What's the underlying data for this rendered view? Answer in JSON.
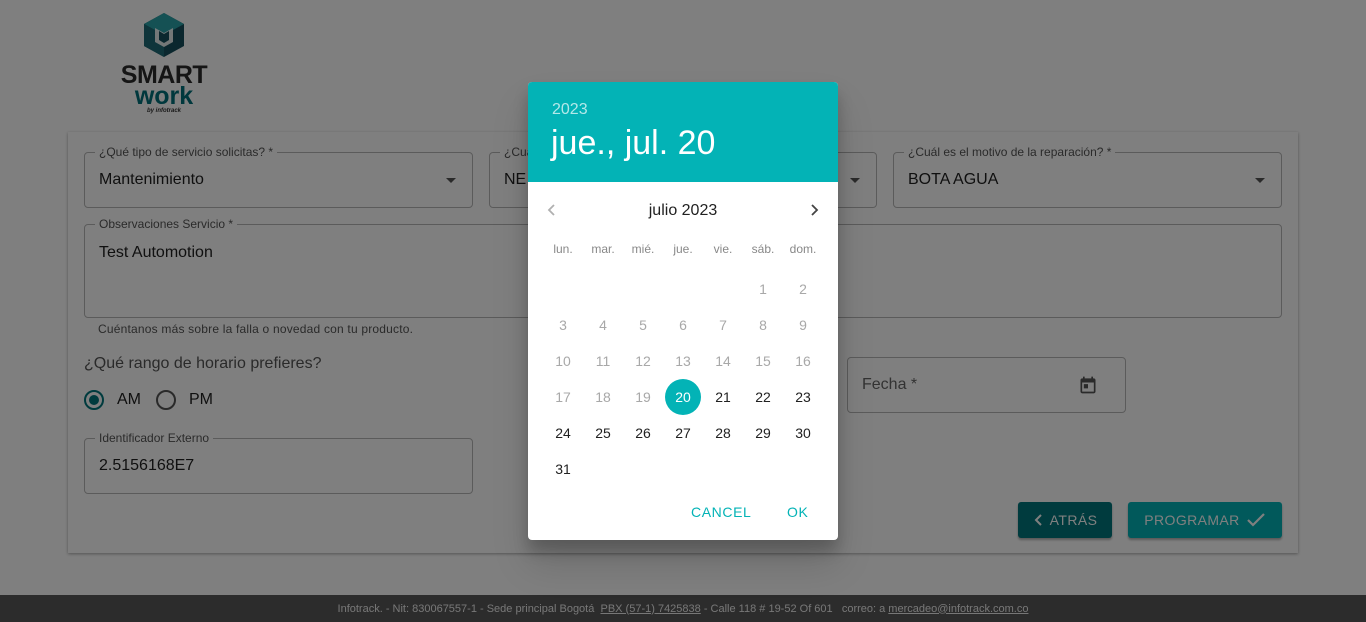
{
  "brand": {
    "line1": "SMART",
    "line2": "work",
    "line3": "by infotrack"
  },
  "form": {
    "service_type": {
      "label": "¿Qué tipo de servicio solicitas? *",
      "value": "Mantenimiento"
    },
    "product": {
      "label": "¿Cuá",
      "value": "NE"
    },
    "reason": {
      "label": "¿Cuál es el motivo de la reparación? *",
      "value": "BOTA AGUA"
    },
    "observations": {
      "label": "Observaciones Servicio *",
      "value": "Test Automotion",
      "help": "Cuéntanos más sobre la falla o novedad con tu producto."
    },
    "schedule": {
      "question": "¿Qué rango de horario prefieres?",
      "am": "AM",
      "pm": "PM",
      "selected": "AM"
    },
    "external_id": {
      "label": "Identificador Externo",
      "value": "2.5156168E7"
    },
    "date": {
      "label": "Fecha *"
    },
    "back_button": "ATRÁS",
    "submit_button": "PROGRAMAR"
  },
  "footer": {
    "company": "Infotrack. - Nit: 830067557-1 - Sede principal Bogotá",
    "phone": "PBX (57-1) 7425838",
    "address": " - Calle 118 # 19-52 Of 601   correo: a ",
    "email": "mercadeo@infotrack.com.co"
  },
  "datepicker": {
    "year": "2023",
    "selected_label": "jue., jul. 20",
    "month_label": "julio 2023",
    "weekdays": [
      "lun.",
      "mar.",
      "mié.",
      "jue.",
      "vie.",
      "sáb.",
      "dom."
    ],
    "first_weekday_index": 5,
    "days_in_month": 31,
    "selected_day": 20,
    "min_enabled_day": 21,
    "cancel_label": "CANCEL",
    "ok_label": "OK"
  },
  "colors": {
    "accent": "#03b3b6",
    "primary_dark": "#00767c",
    "footer_bg": "#595959"
  },
  "icons": [
    "chevron-left-icon",
    "chevron-right-icon",
    "calendar-icon",
    "dropdown-arrow-icon",
    "check-icon"
  ]
}
